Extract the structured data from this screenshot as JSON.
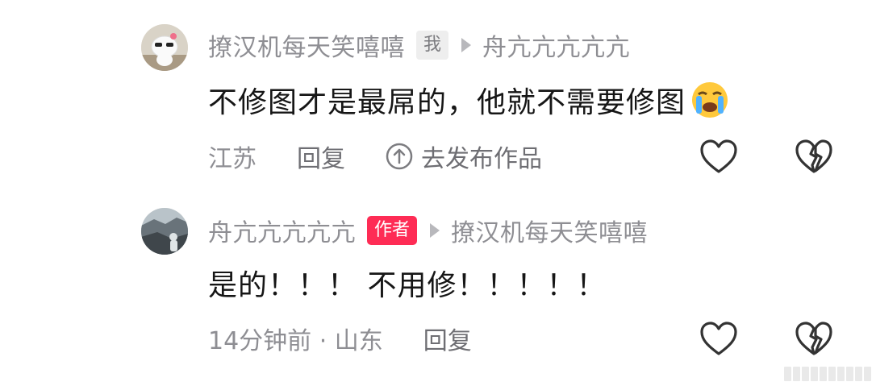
{
  "comments": [
    {
      "username": "撩汉机每天笑嘻嘻",
      "tag": "我",
      "reply_to": "舟亢亢亢亢亢",
      "text": "不修图才是最屌的，他就不需要修图",
      "emoji": "loudly-crying-face",
      "location": "江苏",
      "reply_label": "回复",
      "go_publish_label": "去发布作品"
    },
    {
      "username": "舟亢亢亢亢亢",
      "tag": "作者",
      "reply_to": "撩汉机每天笑嘻嘻",
      "text": "是的！！！ 不用修！！！！！",
      "time_location": "14分钟前 · 山东",
      "reply_label": "回复"
    }
  ],
  "colors": {
    "author_tag": "#fe2c55",
    "meta_text": "#8e8e93",
    "body_text": "#161616"
  }
}
